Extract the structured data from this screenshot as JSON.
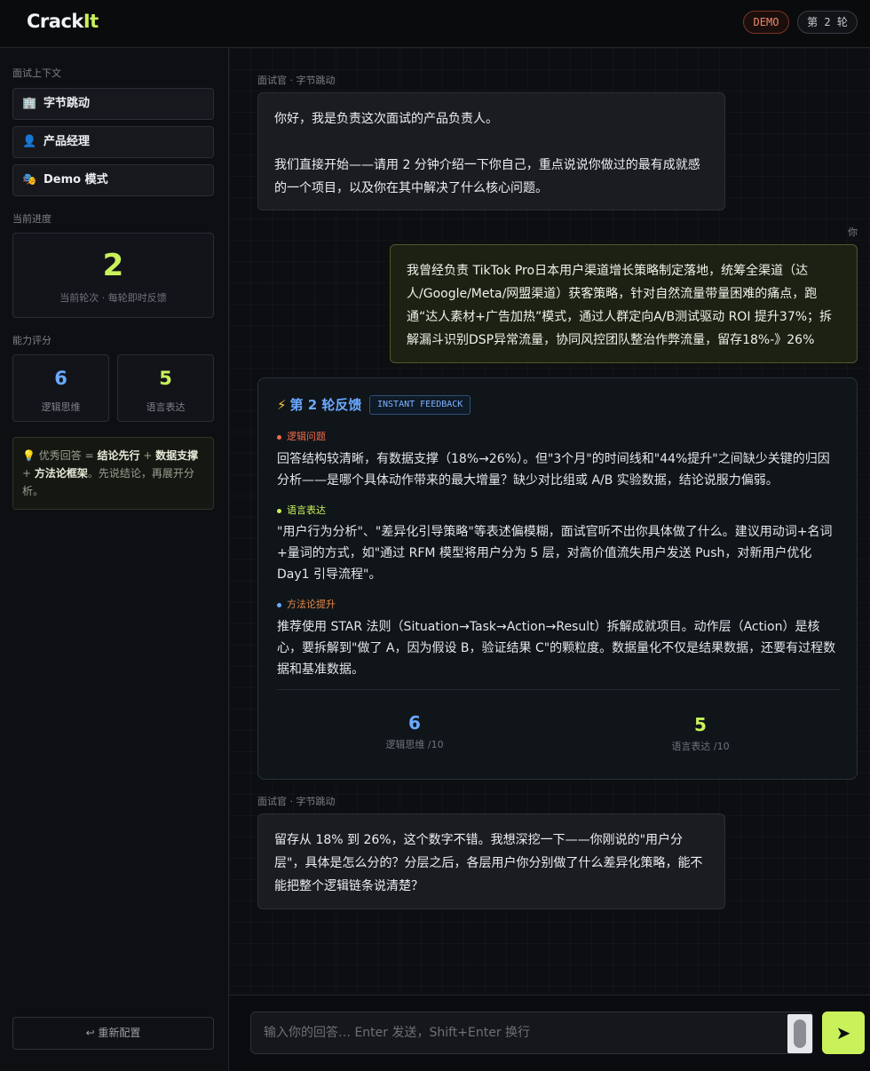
{
  "header": {
    "logo_main": "Crack",
    "logo_accent": "It",
    "demo_badge": "DEMO",
    "round_badge": "第 2 轮"
  },
  "sidebar": {
    "context_label": "面试上下文",
    "context_items": [
      {
        "icon": "🏢",
        "label": "字节跳动",
        "icon_name": "building-icon"
      },
      {
        "icon": "👤",
        "label": "产品经理",
        "icon_name": "person-icon"
      },
      {
        "icon": "🎭",
        "label": "Demo 模式",
        "icon_name": "masks-icon"
      }
    ],
    "progress_label": "当前进度",
    "progress_value": "2",
    "progress_caption": "当前轮次 · 每轮即时反馈",
    "ability_label": "能力评分",
    "scores": [
      {
        "value": "6",
        "label": "逻辑思维",
        "color": "#6aa9ff"
      },
      {
        "value": "5",
        "label": "语言表达",
        "color": "#c9f25a"
      }
    ],
    "tip": {
      "icon": "💡",
      "t1": "优秀回答 = ",
      "b1": "结论先行",
      "t2": " + ",
      "b2": "数据支撑",
      "t3": " + ",
      "b3": "方法论框架",
      "t4": "。先说结论，再展开分析。"
    },
    "reset_label": "↩ 重新配置"
  },
  "chat": {
    "msg1_meta": "面试官 · 字节跳动",
    "msg1_line1": "你好，我是负责这次面试的产品负责人。",
    "msg1_line2": "我们直接开始——请用 2 分钟介绍一下你自己，重点说说你做过的最有成就感的一个项目，以及你在其中解决了什么核心问题。",
    "me_meta": "你",
    "me_text": "我曾经负责 TikTok Pro日本用户渠道增长策略制定落地，统筹全渠道（达人/Google/Meta/网盟渠道）获客策略，针对自然流量带量困难的痛点，跑通“达人素材+广告加热”模式，通过人群定向A/B测试驱动 ROI 提升37%；拆解漏斗识别DSP异常流量，协同风控团队整治作弊流量，留存18%-》26%",
    "feedback": {
      "bolt": "⚡",
      "title": "第 2 轮反馈",
      "tag": "INSTANT FEEDBACK",
      "sections": [
        {
          "title": "逻辑问题",
          "color": "#f26b4b",
          "text": "回答结构较清晰，有数据支撑（18%→26%）。但\"3个月\"的时间线和\"44%提升\"之间缺少关键的归因分析——是哪个具体动作带来的最大增量？缺少对比组或 A/B 实验数据，结论说服力偏弱。"
        },
        {
          "title": "语言表达",
          "color": "#c9f25a",
          "text": "\"用户行为分析\"、\"差异化引导策略\"等表述偏模糊，面试官听不出你具体做了什么。建议用动词+名词+量词的方式，如\"通过 RFM 模型将用户分为 5 层，对高价值流失用户发送 Push，对新用户优化 Day1 引导流程\"。"
        },
        {
          "title": "方法论提升",
          "color": "#e98a4a",
          "text": "推荐使用 STAR 法则（Situation→Task→Action→Result）拆解成就项目。动作层（Action）是核心，要拆解到\"做了 A，因为假设 B，验证结果 C\"的颗粒度。数据量化不仅是结果数据，还要有过程数据和基准数据。"
        }
      ],
      "scores": [
        {
          "value": "6",
          "label": "逻辑思维 /10",
          "color": "#6aa9ff"
        },
        {
          "value": "5",
          "label": "语言表达 /10",
          "color": "#c9f25a"
        }
      ]
    },
    "msg2_meta": "面试官 · 字节跳动",
    "msg2_text": "留存从 18% 到 26%，这个数字不错。我想深挖一下——你刚说的\"用户分层\"，具体是怎么分的？分层之后，各层用户你分别做了什么差异化策略，能不能把整个逻辑链条说清楚？"
  },
  "composer": {
    "placeholder": "输入你的回答… Enter 发送，Shift+Enter 换行",
    "send_icon": "➤"
  }
}
